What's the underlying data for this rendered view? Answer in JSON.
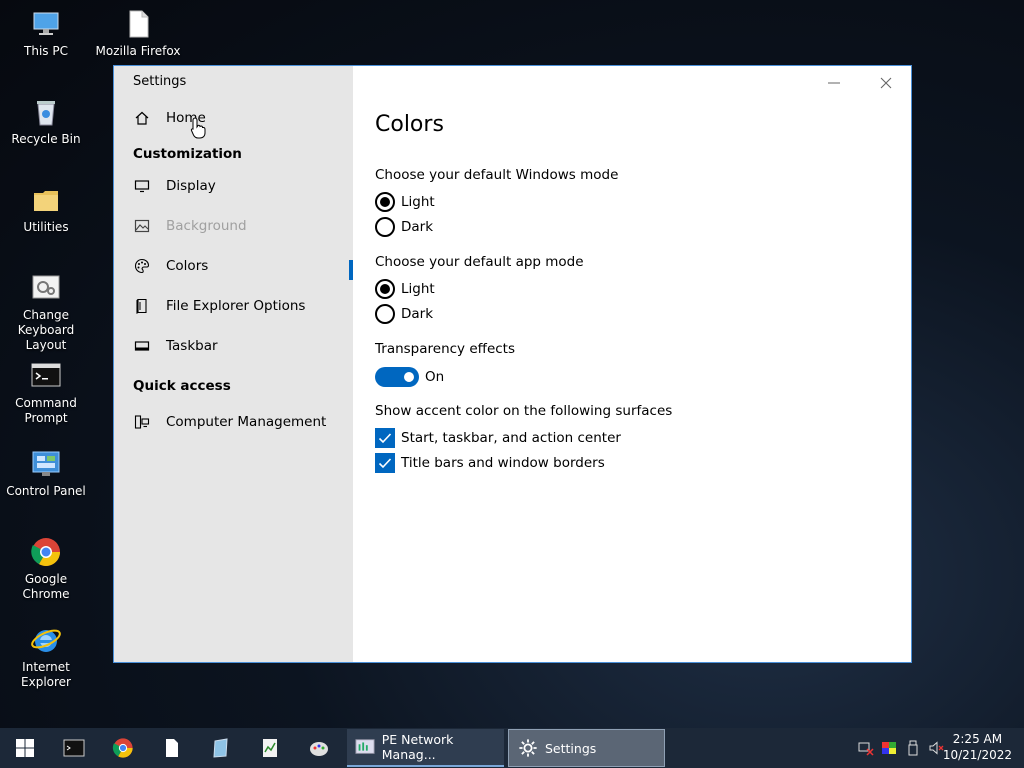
{
  "desktop": {
    "icons": [
      {
        "label": "This PC"
      },
      {
        "label": "Mozilla Firefox"
      },
      {
        "label": "Recycle Bin"
      },
      {
        "label": "Utilities"
      },
      {
        "label": "Change Keyboard Layout"
      },
      {
        "label": "Command Prompt"
      },
      {
        "label": "Control Panel"
      },
      {
        "label": "Google Chrome"
      },
      {
        "label": "Internet Explorer"
      }
    ]
  },
  "window": {
    "app_title": "Settings",
    "sidebar": {
      "home": "Home",
      "section_customization": "Customization",
      "items": [
        {
          "label": "Display"
        },
        {
          "label": "Background"
        },
        {
          "label": "Colors"
        },
        {
          "label": "File Explorer Options"
        },
        {
          "label": "Taskbar"
        }
      ],
      "section_quick_access": "Quick access",
      "quick_items": [
        {
          "label": "Computer Management"
        }
      ]
    },
    "content": {
      "title": "Colors",
      "windows_mode": {
        "label": "Choose your default Windows mode",
        "options": [
          "Light",
          "Dark"
        ],
        "selected": "Light"
      },
      "app_mode": {
        "label": "Choose your default app mode",
        "options": [
          "Light",
          "Dark"
        ],
        "selected": "Light"
      },
      "transparency": {
        "label": "Transparency effects",
        "state": "On"
      },
      "accent": {
        "label": "Show accent color on the following surfaces",
        "options": [
          {
            "label": "Start, taskbar, and action center",
            "checked": true
          },
          {
            "label": "Title bars and window borders",
            "checked": true
          }
        ]
      }
    }
  },
  "taskbar": {
    "tasks": [
      {
        "label": "PE Network Manag..."
      },
      {
        "label": "Settings"
      }
    ],
    "clock": {
      "time": "2:25 AM",
      "date": "10/21/2022"
    }
  },
  "colors": {
    "accent": "#0067c0",
    "taskbar": "#1c2838",
    "sidebar": "#e6e6e6"
  }
}
